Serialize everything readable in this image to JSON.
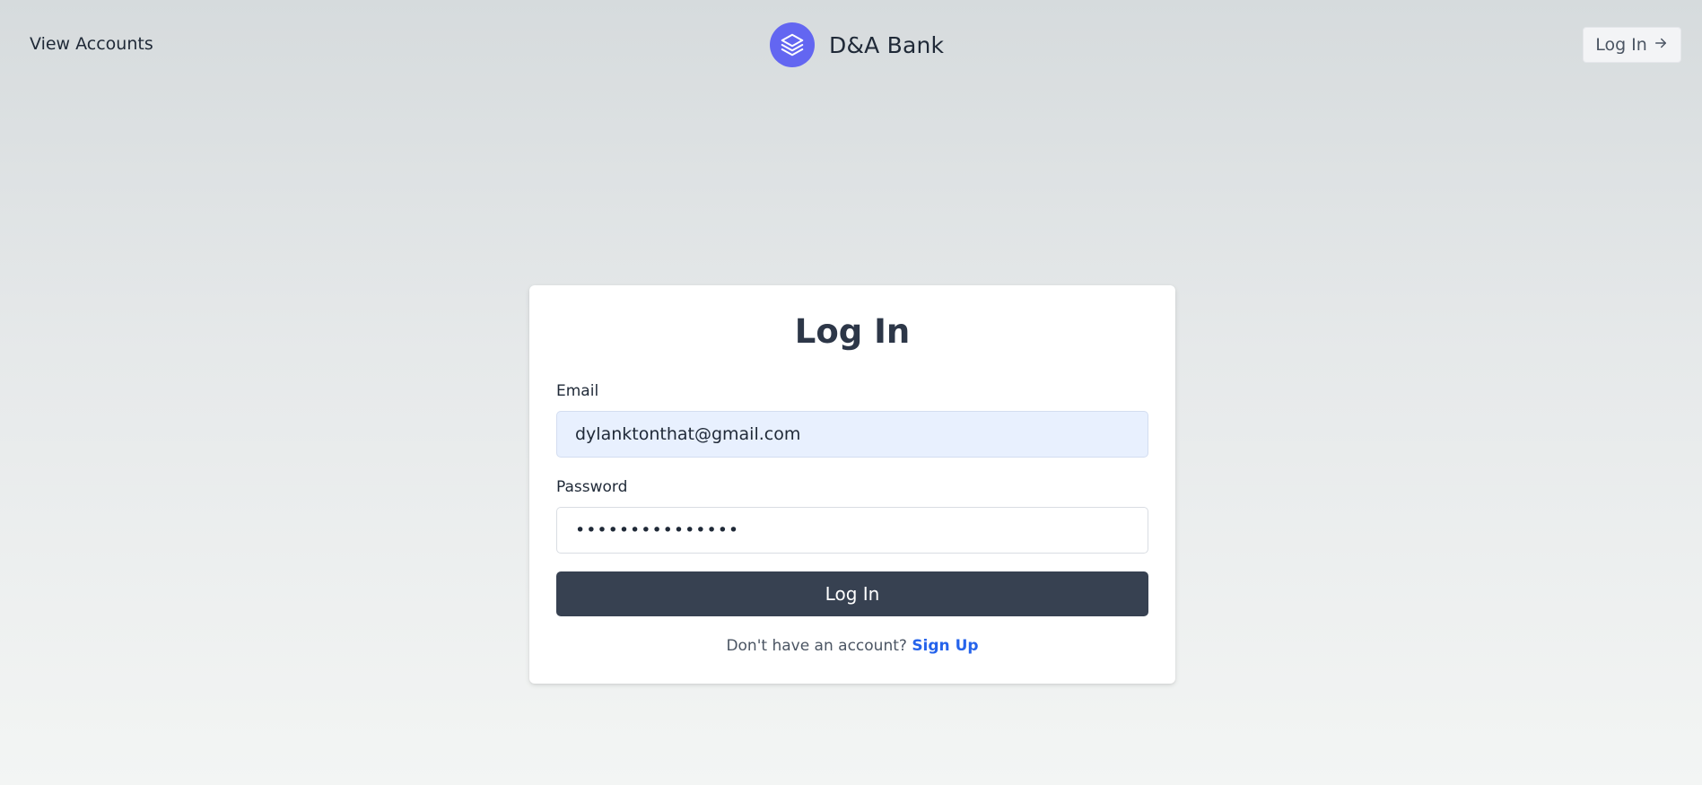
{
  "header": {
    "nav_link": "View Accounts",
    "brand_name": "D&A Bank",
    "brand_icon": "layers-icon",
    "login_label": "Log In",
    "login_icon": "arrow-right-icon"
  },
  "form": {
    "title": "Log In",
    "email_label": "Email",
    "email_value": "dylanktonthat@gmail.com",
    "password_label": "Password",
    "password_value": "•••••••••••••••",
    "submit_label": "Log In",
    "signup_prompt": "Don't have an account?",
    "signup_link": "Sign Up"
  },
  "colors": {
    "accent": "#6366f1",
    "button": "#374151",
    "link": "#2563eb",
    "autofill": "#e8f0fe"
  }
}
